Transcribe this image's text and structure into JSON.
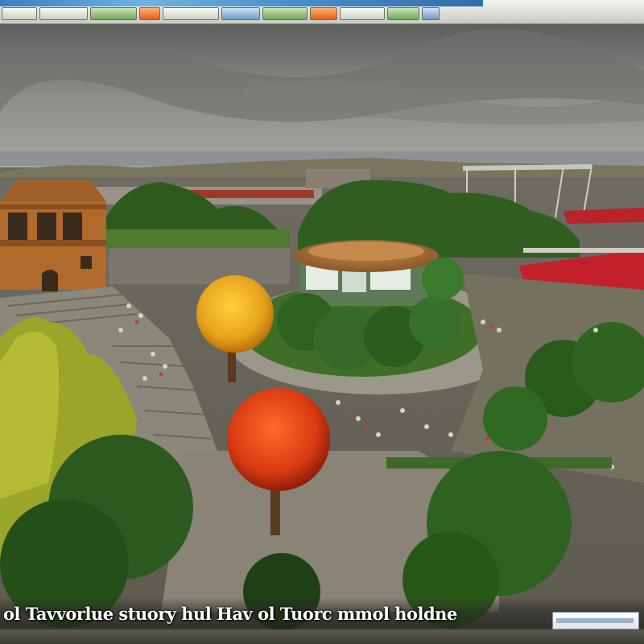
{
  "window": {
    "title": ""
  },
  "toolbar": {
    "buttons": [
      {
        "id": "file",
        "label": ""
      },
      {
        "id": "view",
        "label": ""
      },
      {
        "id": "scenery",
        "label": ""
      },
      {
        "id": "rides",
        "label": ""
      },
      {
        "id": "shops",
        "label": ""
      },
      {
        "id": "staff",
        "label": ""
      },
      {
        "id": "finance",
        "label": ""
      },
      {
        "id": "research",
        "label": ""
      },
      {
        "id": "guests",
        "label": ""
      },
      {
        "id": "map",
        "label": ""
      },
      {
        "id": "options",
        "label": ""
      }
    ]
  },
  "caption": {
    "text": "ol Tavvorlue stuory hul Hav ol Tuorc mmol holdne"
  },
  "status_box": {
    "text": ""
  },
  "colors": {
    "sky": "#8a8a86",
    "grass": "#3e6e28",
    "path": "#8d8a7e",
    "roof": "#b5763a",
    "orange_tree": "#e6a21c",
    "red_tree": "#d93a12",
    "stand_red": "#c4202a"
  },
  "icons": [
    "park-scene",
    "tree-icon",
    "building-icon",
    "stadium-icon"
  ]
}
